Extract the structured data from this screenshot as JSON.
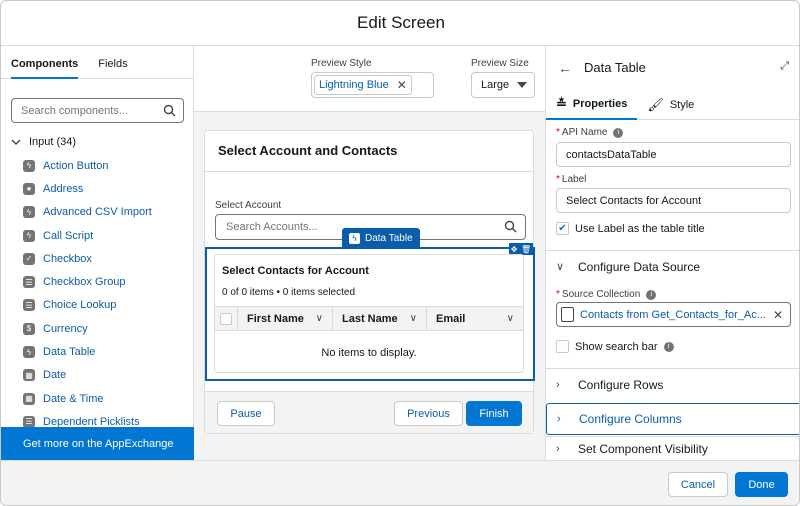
{
  "window": {
    "title": "Edit Screen"
  },
  "left": {
    "tabs": [
      "Components",
      "Fields"
    ],
    "search_placeholder": "Search components...",
    "group": "Input (34)",
    "items": [
      {
        "label": "Action Button",
        "icon": "bolt-icon"
      },
      {
        "label": "Address",
        "icon": "location-pin-icon"
      },
      {
        "label": "Advanced CSV Import",
        "icon": "bolt-icon"
      },
      {
        "label": "Call Script",
        "icon": "bolt-icon"
      },
      {
        "label": "Checkbox",
        "icon": "checkbox-icon"
      },
      {
        "label": "Checkbox Group",
        "icon": "checkbox-group-icon"
      },
      {
        "label": "Choice Lookup",
        "icon": "list-icon"
      },
      {
        "label": "Currency",
        "icon": "currency-icon"
      },
      {
        "label": "Data Table",
        "icon": "bolt-icon"
      },
      {
        "label": "Date",
        "icon": "calendar-icon"
      },
      {
        "label": "Date & Time",
        "icon": "calendar-icon"
      },
      {
        "label": "Dependent Picklists",
        "icon": "list-icon"
      }
    ],
    "appexchange": "Get more on the AppExchange"
  },
  "preview": {
    "style_label": "Preview Style",
    "style_value": "Lightning Blue",
    "size_label": "Preview Size",
    "size_value": "Large"
  },
  "card": {
    "title": "Select Account and Contacts",
    "select_account_label": "Select Account",
    "select_account_placeholder": "Search Accounts...",
    "data_table_tag": "Data Table",
    "table": {
      "title": "Select Contacts for Account",
      "count": "0 of 0 items • 0 items selected",
      "columns": [
        "First Name",
        "Last Name",
        "Email"
      ],
      "empty": "No items to display."
    },
    "pause": "Pause",
    "previous": "Previous",
    "finish": "Finish"
  },
  "props": {
    "title": "Data Table",
    "tab_properties": "Properties",
    "tab_style": "Style",
    "api_name_label": "API Name",
    "api_name_value": "contactsDataTable",
    "label_label": "Label",
    "label_value": "Select Contacts for Account",
    "use_label_title": "Use Label as the table title",
    "section_data_source": "Configure Data Source",
    "source_collection_label": "Source Collection",
    "source_collection_value": "Contacts from Get_Contacts_for_Ac...",
    "show_search": "Show search bar",
    "section_rows": "Configure Rows",
    "section_columns": "Configure Columns",
    "section_visibility": "Set Component Visibility"
  },
  "footer": {
    "cancel": "Cancel",
    "done": "Done"
  },
  "colors": {
    "brand": "#0176d3",
    "link": "#0b5cab"
  }
}
